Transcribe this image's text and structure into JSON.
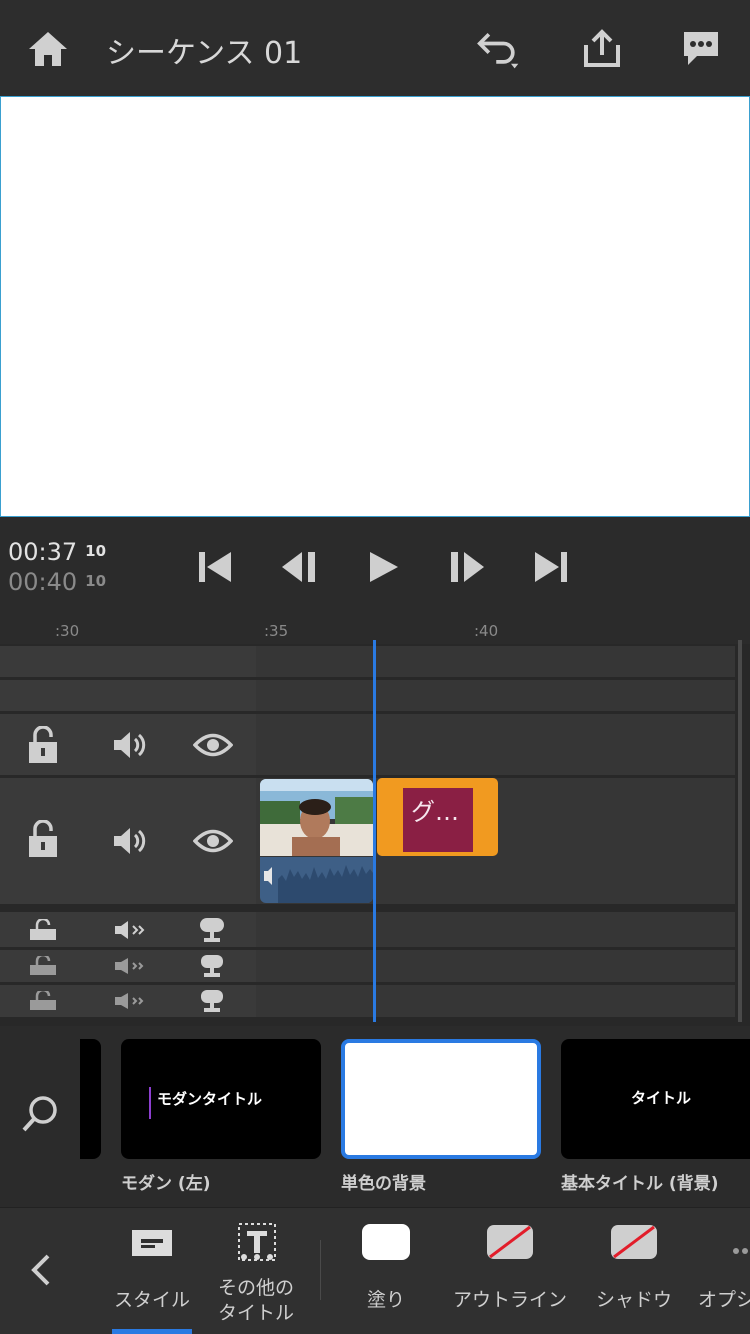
{
  "header": {
    "title": "シーケンス 01",
    "icons": [
      "home-icon",
      "undo-icon",
      "share-icon",
      "feedback-icon"
    ]
  },
  "transport": {
    "current_time": "00:37",
    "current_frame": "10",
    "duration_time": "00:40",
    "duration_frame": "10",
    "buttons": [
      "go-to-start",
      "step-back",
      "play",
      "step-forward",
      "go-to-end"
    ]
  },
  "ruler": {
    "labels": [
      ":30",
      ":35",
      ":40"
    ]
  },
  "timeline": {
    "title_clip_text": "グ…"
  },
  "style_browser": {
    "cards": [
      {
        "label": "モダン (左)",
        "preview_text": "モダンタイトル",
        "selected": false
      },
      {
        "label": "単色の背景",
        "preview_text": "",
        "selected": true
      },
      {
        "label": "基本タイトル (背景)",
        "preview_text": "タイトル",
        "selected": false
      }
    ]
  },
  "bottom_bar": {
    "items": [
      {
        "label": "スタイル",
        "active": true
      },
      {
        "label_line1": "その他の",
        "label_line2": "タイトル"
      },
      {
        "label": "塗り"
      },
      {
        "label": "アウトライン"
      },
      {
        "label": "シャドウ"
      },
      {
        "label": "オプシ"
      }
    ]
  },
  "colors": {
    "accent": "#2a7ae2",
    "title_clip": "#f19a20",
    "title_clip_inner": "#8a1f44",
    "audio_clip": "#3e5f86"
  }
}
